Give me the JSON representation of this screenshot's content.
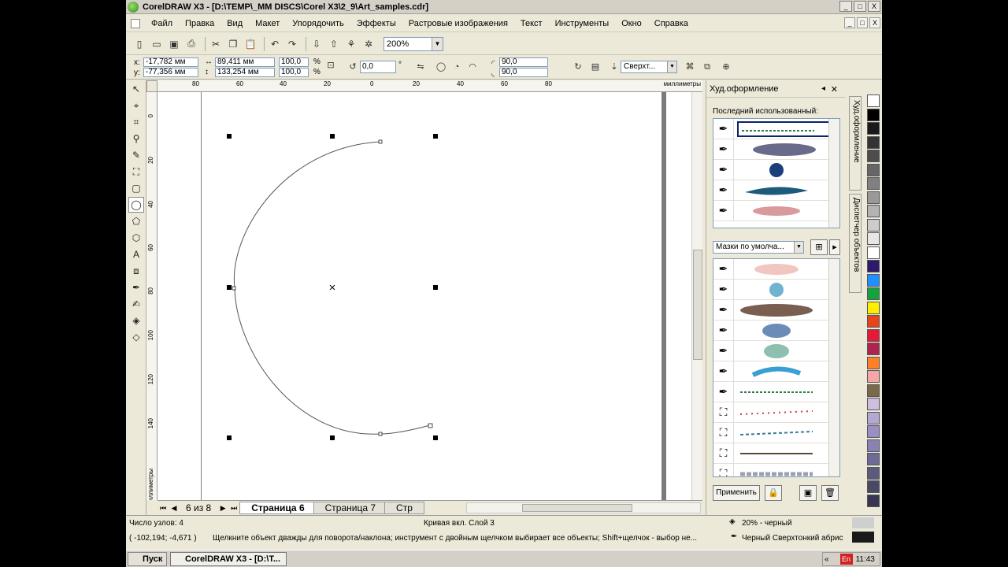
{
  "window": {
    "title": "CorelDRAW X3 - [D:\\TEMP\\_MM DISCS\\Corel X3\\2_9\\Art_samples.cdr]",
    "buttons": [
      "_",
      "□",
      "X"
    ]
  },
  "menu": {
    "items": [
      "Файл",
      "Правка",
      "Вид",
      "Макет",
      "Упорядочить",
      "Эффекты",
      "Растровые изображения",
      "Текст",
      "Инструменты",
      "Окно",
      "Справка"
    ],
    "window_buttons": [
      "_",
      "□",
      "X"
    ]
  },
  "toolbar": {
    "zoom": "200%"
  },
  "propbar": {
    "x_label": "x:",
    "x": "-17,782 мм",
    "y_label": "y:",
    "y": "-77,356 мм",
    "width": "89,411 мм",
    "height": "133,254 мм",
    "scale_x": "100,0",
    "scale_y": "100,0",
    "percent": "%",
    "rotation": "0,0",
    "degree": "°",
    "angle_start": "90,0",
    "angle_end": "90,0",
    "outline": "Сверхт..."
  },
  "ruler": {
    "h_labels": [
      "80",
      "60",
      "40",
      "20",
      "0",
      "20",
      "40",
      "60",
      "80"
    ],
    "unit": "миллиметры",
    "v_labels": [
      "0",
      "20",
      "40",
      "60",
      "80",
      "100",
      "120",
      "140"
    ],
    "v_unit": "миллиметры"
  },
  "pagenav": {
    "count": "6 из 8",
    "tabs": [
      "Страница 6",
      "Страница 7",
      "Стр"
    ]
  },
  "docker": {
    "title": "Худ.оформление",
    "recent_label": "Последний использованный:",
    "category": "Мазки по умолча...",
    "apply": "Применить",
    "vtabs": [
      "Худ.оформление",
      "Диспетчер объектов"
    ]
  },
  "palette": {
    "colors": [
      "#ffffff",
      "#000000",
      "#1a1a1a",
      "#333333",
      "#4d4d4d",
      "#666666",
      "#808080",
      "#999999",
      "#b3b3b3",
      "#cccccc",
      "#e6e6e6",
      "#ffffff",
      "#2e1a6b",
      "#1e90ff",
      "#14a33c",
      "#ffee00",
      "#e8431b",
      "#e61a36",
      "#b0234e",
      "#ff7f27",
      "#f5a7a7",
      "#7a6a4a",
      "#cdbfe0",
      "#b3a7d4",
      "#9a8fc4",
      "#8a82b6",
      "#706a98",
      "#5e5a7e",
      "#4a4866",
      "#383652"
    ],
    "accent": "#0a246a"
  },
  "status": {
    "nodes": "Число узлов: 4",
    "layer": "Кривая вкл. Слой 3",
    "fill": "20% - черный",
    "coords": "( -102,194; -4,671 )",
    "hint": "Щелкните объект дважды для поворота/наклона; инструмент с двойным щелчком выбирает все объекты; Shift+щелчок - выбор не...",
    "outline": "Черный  Сверхтонкий абрис"
  },
  "taskbar": {
    "start": "Пуск",
    "task": "CorelDRAW X3 - [D:\\T...",
    "lang": "En",
    "time": "11:43"
  }
}
